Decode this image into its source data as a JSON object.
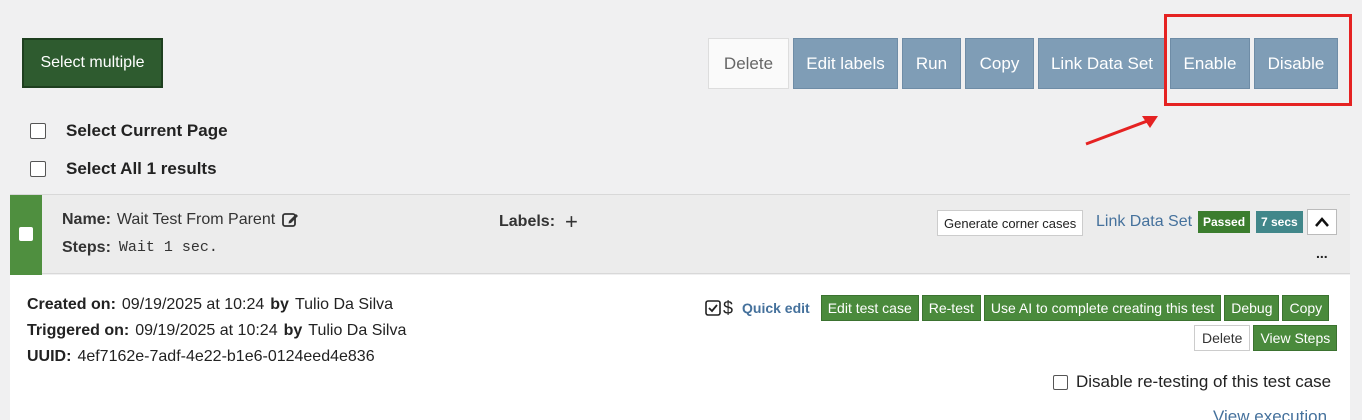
{
  "toolbar": {
    "select_multiple": "Select multiple",
    "actions": [
      "Delete",
      "Edit labels",
      "Run",
      "Copy",
      "Link Data Set",
      "Enable",
      "Disable"
    ]
  },
  "selection": {
    "current_page": "Select Current Page",
    "all_results": "Select All 1 results"
  },
  "test_case": {
    "name_label": "Name:",
    "name": "Wait Test From Parent",
    "steps_label": "Steps:",
    "steps": "Wait 1 sec.",
    "labels_label": "Labels:",
    "add_label": "+",
    "generate_corner_cases": "Generate corner cases",
    "link_data_set": "Link Data Set",
    "status": "Passed",
    "duration": "7 secs",
    "more": "...",
    "created_label": "Created on:",
    "created_date": "09/19/2025 at 10:24",
    "created_by_label": "by",
    "created_by": "Tulio Da Silva",
    "triggered_label": "Triggered on:",
    "triggered_date": "09/19/2025 at 10:24",
    "triggered_by_label": "by",
    "triggered_by": "Tulio Da Silva",
    "uuid_label": "UUID:",
    "uuid": "4ef7162e-7adf-4e22-b1e6-0124eed4e836",
    "dollar": "$",
    "quick_edit": "Quick edit",
    "row1_buttons": [
      "Edit test case",
      "Re-test",
      "Use AI to complete creating this test",
      "Debug",
      "Copy"
    ],
    "delete": "Delete",
    "view_steps": "View Steps",
    "disable_retesting": "Disable re-testing of this test case",
    "view_execution": "View execution"
  },
  "colors": {
    "accent_blue": "#7f9db6",
    "green": "#4a8a3c",
    "highlight_red": "#e52222"
  }
}
